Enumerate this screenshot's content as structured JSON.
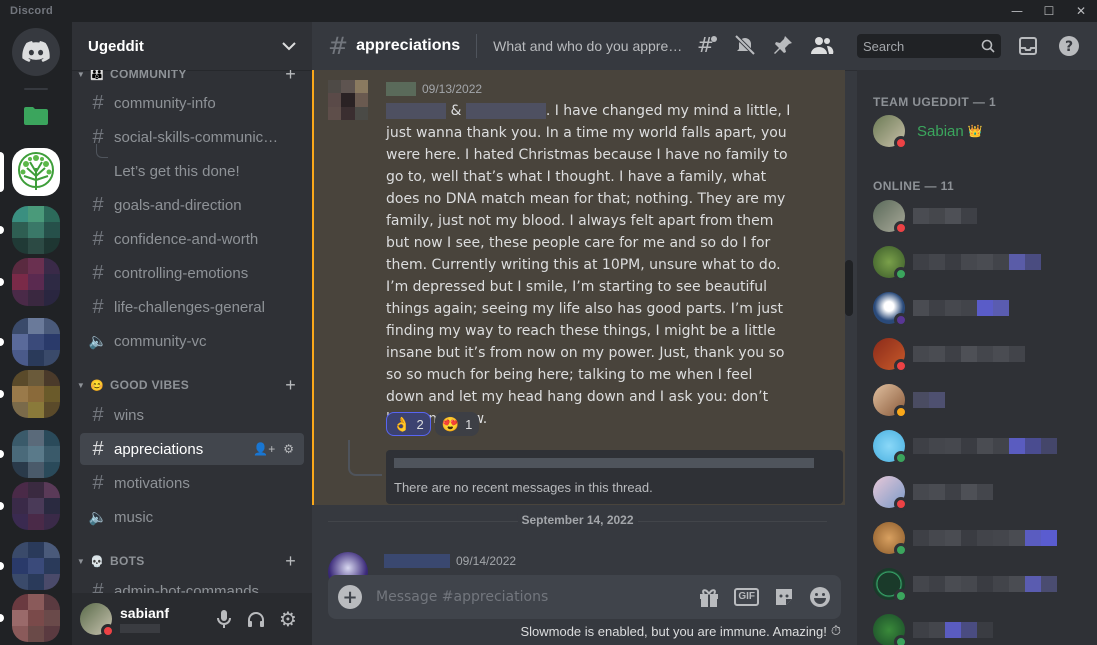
{
  "app": {
    "title": "Discord"
  },
  "server": {
    "name": "Ugeddit"
  },
  "categories": {
    "community": "COMMUNITY",
    "good_vibes": "GOOD VIBES",
    "bots": "BOTS"
  },
  "channels": {
    "community_info": "community-info",
    "social_skills": "social-skills-communic…",
    "thread": "Let’s get this done!",
    "goals": "goals-and-direction",
    "confidence": "confidence-and-worth",
    "controlling": "controlling-emotions",
    "life": "life-challenges-general",
    "vc": "community-vc",
    "wins": "wins",
    "appreciations": "appreciations",
    "motivations": "motivations",
    "music": "music",
    "admin_bot": "admin-bot-commands"
  },
  "user": {
    "name": "sabianf"
  },
  "header": {
    "channel": "appreciations",
    "topic": "What and who do you appreci…",
    "search_placeholder": "Search"
  },
  "message": {
    "timestamp": "09/13/2022",
    "text": ". I have changed my mind a little, I just wanna thank you. In a time my world falls apart, you were here. I hated Christmas because I have no family to go to, well that’s what I thought. I have a family, what does no DNA match mean for that; nothing. They are my family, just not my blood. I always felt apart from them but now I see, these people care for me and so do I for them. Currently writing this at 10PM, unsure what to do. I’m depressed but I smile, I’m starting to see beautiful things again; seeing my life also has good parts. I’m just finding my way to reach these things, I might be a little insane but it’s from now on my power. Just, thank you so so so much for being here; talking to me when I feel down and let my head hang down and I ask you: don’t leave me now.",
    "amp": "&",
    "reactions": [
      {
        "emoji": "👌",
        "count": "2",
        "selected": true
      },
      {
        "emoji": "😍",
        "count": "1",
        "selected": false
      }
    ],
    "thread_status": "There are no recent messages in this thread."
  },
  "divider": {
    "date": "September 14, 2022"
  },
  "message2": {
    "timestamp": "09/14/2022"
  },
  "composer": {
    "placeholder": "Message #appreciations",
    "gif_label": "GIF",
    "slowmode": "Slowmode is enabled, but you are immune. Amazing!"
  },
  "members": {
    "team_header": "TEAM UGEDDIT — 1",
    "owner_name": "Sabian",
    "online_header": "ONLINE — 11"
  },
  "colors": {
    "accent": "#5865f2",
    "mention_highlight": "#faa81a",
    "online": "#3ba55d",
    "dnd": "#ed4245",
    "idle": "#faa81a",
    "owner_name": "#3ba55d"
  }
}
